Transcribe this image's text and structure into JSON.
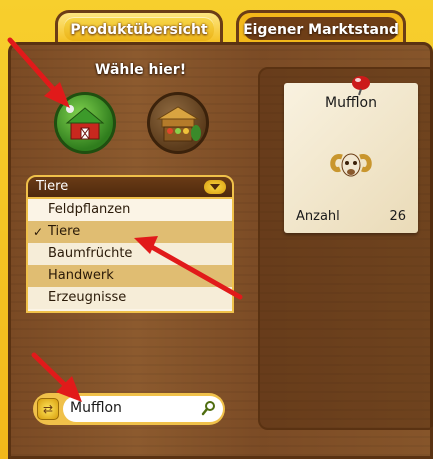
{
  "tabs": [
    {
      "label": "Produktübersicht",
      "active": true
    },
    {
      "label": "Eigener Marktstand",
      "active": false
    }
  ],
  "hint": "Wähle hier!",
  "category_icons": [
    "farm-icon",
    "market-stall-icon"
  ],
  "dropdown": {
    "selected": "Tiere",
    "options": [
      "Feldpflanzen",
      "Tiere",
      "Baumfrüchte",
      "Handwerk",
      "Erzeugnisse"
    ],
    "checked_index": 1
  },
  "search": {
    "value": "Mufflon"
  },
  "product": {
    "name": "Mufflon",
    "quantity_label": "Anzahl",
    "quantity_value": "26",
    "image_icon": "mufflon-icon"
  },
  "colors": {
    "frame": "#f6c21c",
    "wood": "#7a4a24",
    "arrow": "#e11a1a",
    "selection": "#e0bd72"
  }
}
